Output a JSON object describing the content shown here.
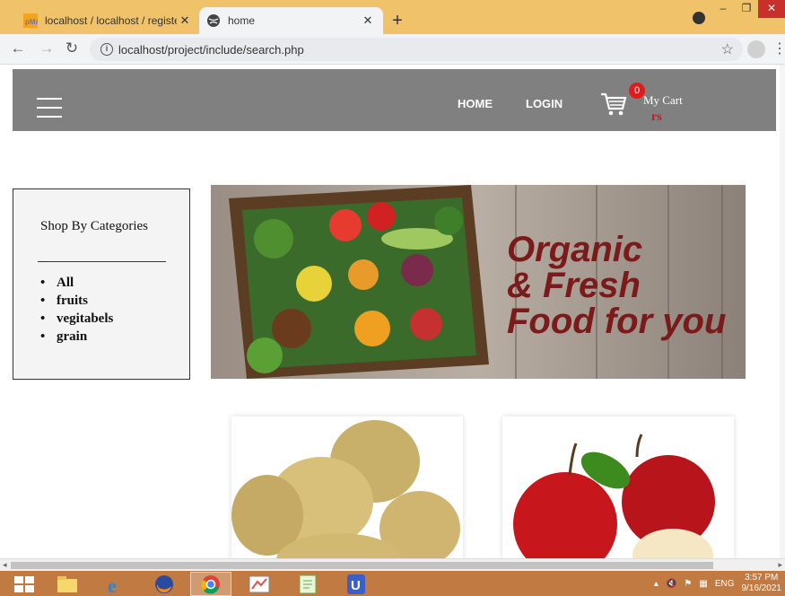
{
  "browser": {
    "tabs": [
      {
        "title": "localhost / localhost / register / u",
        "active": false
      },
      {
        "title": "home",
        "active": true
      }
    ],
    "url": "localhost/project/include/search.php"
  },
  "navbar": {
    "home": "HOME",
    "login": "LOGIN",
    "cart_count": "0",
    "cart_label": "My Cart",
    "cart_price": "rs"
  },
  "categories": {
    "title": "Shop By Categories",
    "items": [
      "All",
      "fruits",
      "vegitabels",
      "grain"
    ]
  },
  "banner": {
    "line1": "Organic",
    "line2": "& Fresh",
    "line3": "Food for you"
  },
  "products": [
    {
      "image": "potatoes-image"
    },
    {
      "image": "apples-image"
    }
  ],
  "taskbar": {
    "lang": "ENG",
    "time": "3:57 PM",
    "date": "9/16/2021"
  },
  "colors": {
    "tabstrip": "#f0c36a",
    "navbar": "#808080",
    "taskbar": "#c07a42",
    "cart_badge": "#e01b1b",
    "banner_text": "#7a1a1a"
  }
}
